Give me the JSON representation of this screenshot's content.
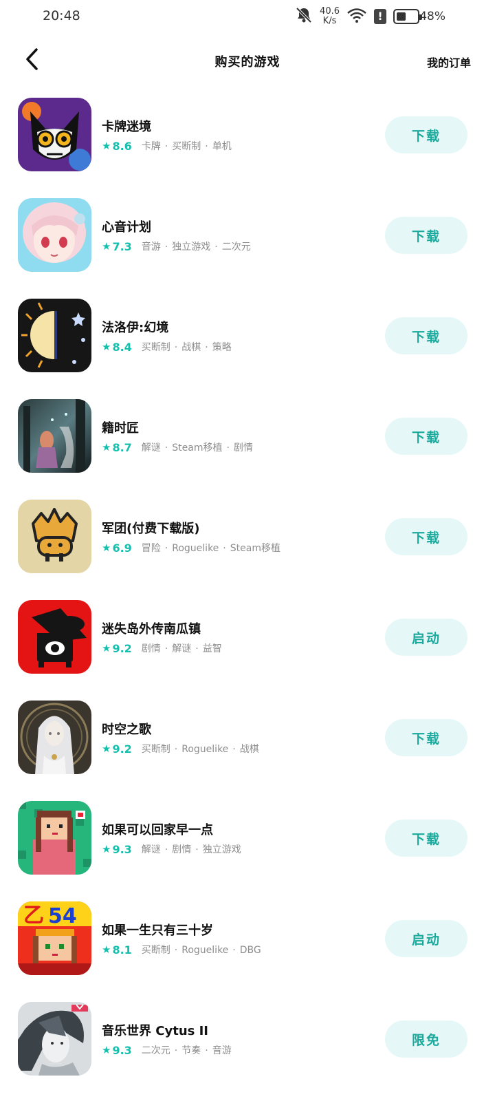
{
  "status_bar": {
    "time": "20:48",
    "net_speed_value": "40.6",
    "net_speed_unit": "K/s",
    "battery_percent": "48%",
    "battery_level": 0.48
  },
  "header": {
    "title": "购买的游戏",
    "orders_link": "我的订单"
  },
  "games": [
    {
      "name": "卡牌迷境",
      "rating": "8.6",
      "tags": [
        "卡牌",
        "买断制",
        "单机"
      ],
      "action": "下载",
      "icon": "cat-mask-icon"
    },
    {
      "name": "心音计划",
      "rating": "7.3",
      "tags": [
        "音游",
        "独立游戏",
        "二次元"
      ],
      "action": "下载",
      "icon": "anime-girl-icon"
    },
    {
      "name": "法洛伊:幻境",
      "rating": "8.4",
      "tags": [
        "买断制",
        "战棋",
        "策略"
      ],
      "action": "下载",
      "icon": "sun-moon-icon"
    },
    {
      "name": "籍时匠",
      "rating": "8.7",
      "tags": [
        "解谜",
        "Steam移植",
        "剧情"
      ],
      "action": "下载",
      "icon": "forest-girl-icon"
    },
    {
      "name": "军团(付费下载版)",
      "rating": "6.9",
      "tags": [
        "冒险",
        "Roguelike",
        "Steam移植"
      ],
      "action": "下载",
      "icon": "crown-creature-icon"
    },
    {
      "name": "迷失岛外传南瓜镇",
      "rating": "9.2",
      "tags": [
        "剧情",
        "解谜",
        "益智"
      ],
      "action": "启动",
      "icon": "hat-monster-icon"
    },
    {
      "name": "时空之歌",
      "rating": "9.2",
      "tags": [
        "买断制",
        "Roguelike",
        "战棋"
      ],
      "action": "下载",
      "icon": "white-hair-girl-icon"
    },
    {
      "name": "如果可以回家早一点",
      "rating": "9.3",
      "tags": [
        "解谜",
        "剧情",
        "独立游戏"
      ],
      "action": "下载",
      "icon": "pixel-girl-icon"
    },
    {
      "name": "如果一生只有三十岁",
      "rating": "8.1",
      "tags": [
        "买断制",
        "Roguelike",
        "DBG"
      ],
      "action": "启动",
      "icon": "pixel-54-icon"
    },
    {
      "name": "音乐世界 Cytus II",
      "rating": "9.3",
      "tags": [
        "二次元",
        "节奏",
        "音游"
      ],
      "action": "限免",
      "icon": "cytus-character-icon"
    }
  ],
  "colors": {
    "accent": "#15bfae",
    "button_bg": "#e5f7f6",
    "button_text": "#1aa99c",
    "tag_text": "#8d8d8d"
  }
}
